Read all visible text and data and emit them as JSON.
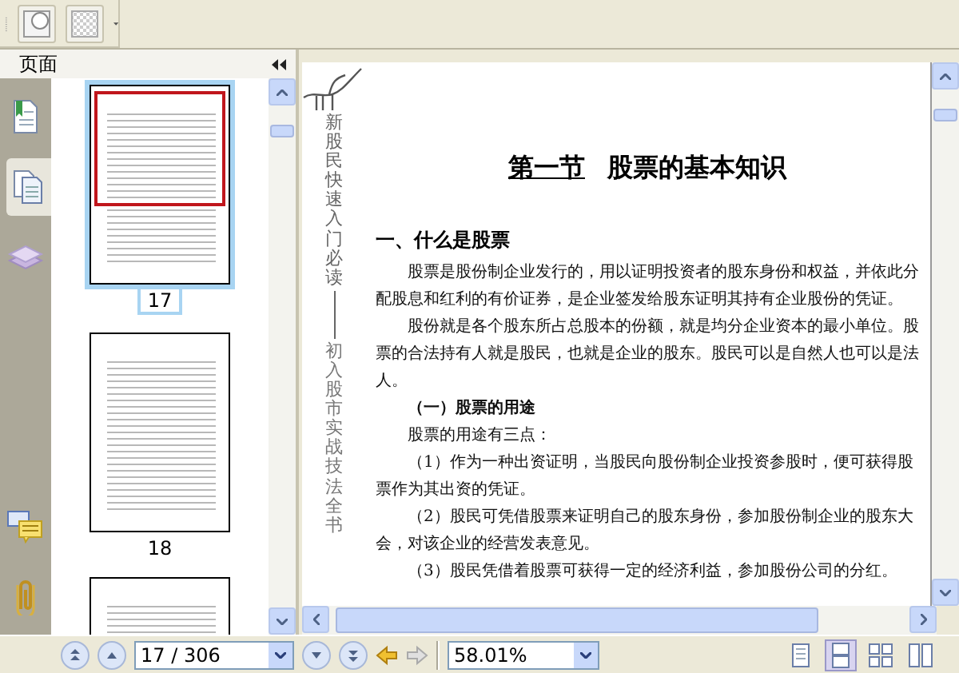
{
  "side_panel": {
    "title": "页面",
    "tabs": [
      {
        "kind": "bookmarks",
        "selected": false
      },
      {
        "kind": "pages",
        "selected": true
      },
      {
        "kind": "layers",
        "selected": false
      },
      {
        "kind": "comments",
        "selected": false
      },
      {
        "kind": "attachments",
        "selected": false
      }
    ],
    "thumbnails": [
      {
        "label": "17",
        "selected": true
      },
      {
        "label": "18",
        "selected": false
      },
      {
        "selected": false
      }
    ]
  },
  "document": {
    "side_title_top": "新股民快速入门必读",
    "side_title_bottom": "初入股市实战技法全书",
    "section_number": "第一节",
    "section_title": "股票的基本知识",
    "subheading": "一、什么是股票",
    "paragraphs": [
      {
        "kind": "body",
        "text": "股票是股份制企业发行的，用以证明投资者的股东身份和权益，并依此分配股息和红利的有价证券，是企业签发给股东证明其持有企业股份的凭证。"
      },
      {
        "kind": "body",
        "text": "股份就是各个股东所占总股本的份额，就是均分企业资本的最小单位。股票的合法持有人就是股民，也就是企业的股东。股民可以是自然人也可以是法人。"
      },
      {
        "kind": "heading",
        "text": "（一）股票的用途"
      },
      {
        "kind": "body",
        "text": "股票的用途有三点："
      },
      {
        "kind": "body",
        "text": "（1）作为一种出资证明，当股民向股份制企业投资参股时，便可获得股票作为其出资的凭证。"
      },
      {
        "kind": "body",
        "text": "（2）股民可凭借股票来证明自己的股东身份，参加股份制企业的股东大会，对该企业的经营发表意见。"
      },
      {
        "kind": "body",
        "text": "（3）股民凭借着股票可获得一定的经济利益，参加股份公司的分红。"
      }
    ]
  },
  "status_bar": {
    "page_field": "17 / 306",
    "zoom_field": "58.01%",
    "nav_buttons": [
      {
        "kind": "first",
        "disabled": false
      },
      {
        "kind": "previous",
        "disabled": false
      }
    ],
    "nav_buttons_after": [
      {
        "kind": "next",
        "disabled": false
      },
      {
        "kind": "last",
        "disabled": false
      },
      {
        "kind": "back",
        "disabled": false
      },
      {
        "kind": "forward",
        "disabled": true
      }
    ],
    "view_modes": [
      {
        "kind": "single",
        "selected": false
      },
      {
        "kind": "continuous",
        "selected": true
      },
      {
        "kind": "grid",
        "selected": false
      },
      {
        "kind": "facing",
        "selected": false
      }
    ]
  }
}
